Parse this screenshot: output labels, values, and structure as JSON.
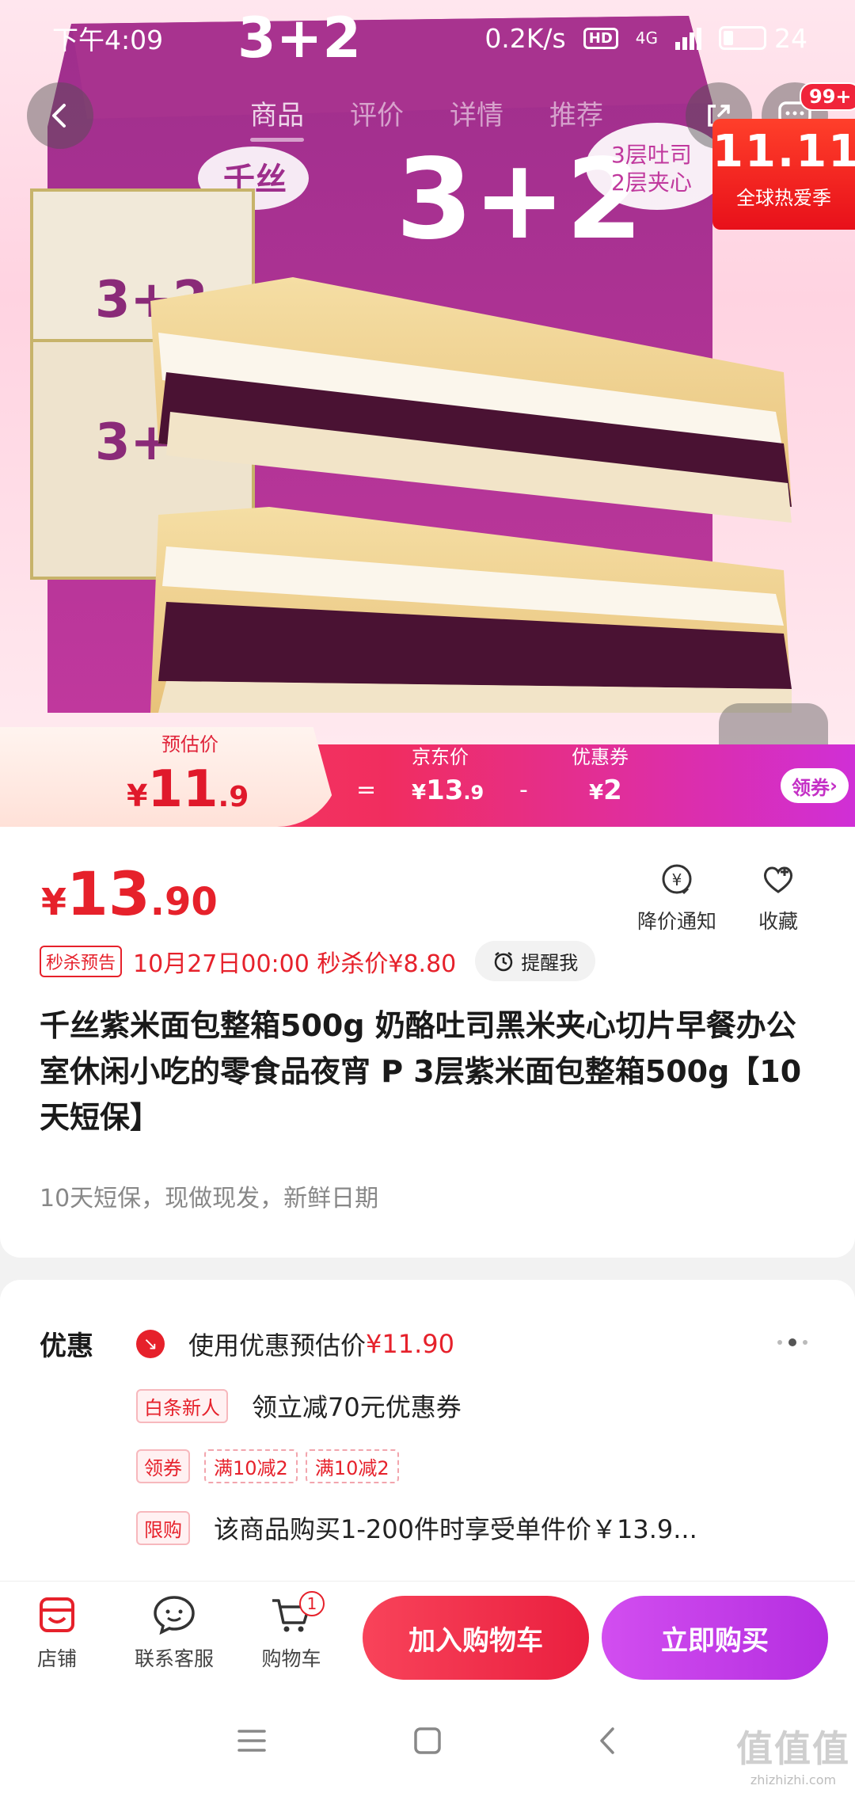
{
  "status_bar": {
    "time": "下午4:09",
    "net_speed": "0.2K/s",
    "hd": "HD",
    "network": "4G",
    "battery": "24"
  },
  "nav": {
    "tabs": [
      "商品",
      "评价",
      "详情",
      "推荐"
    ],
    "active_tab": 0,
    "message_badge": "99+"
  },
  "hero": {
    "product_image": "sandwich-product-photo",
    "brand_logo_text": "千丝",
    "box_text": "3+2",
    "box_side_text": "3层吐司 2层夹心",
    "promo_label_big": "11.11",
    "promo_label_sub": "全球热爱季"
  },
  "price_strip": {
    "est_label": "预估价",
    "est_price": {
      "cur": "¥",
      "int": "11",
      "dec": ".9"
    },
    "eq": "=",
    "jd_label": "京东价",
    "jd_price": {
      "cur": "¥",
      "int": "13",
      "dec": ".9"
    },
    "minus": "-",
    "coupon_label": "优惠券",
    "coupon_price": {
      "cur": "¥",
      "int": "2"
    },
    "claim_label": "领券",
    "claim_arrow": "›"
  },
  "product": {
    "price": {
      "cur": "¥",
      "int": "13",
      "dec": ".90"
    },
    "notify_label": "降价通知",
    "favorite_label": "收藏",
    "flash_tag": "秒杀预告",
    "flash_text": "10月27日00:00 秒杀价¥8.80",
    "remind_label": "提醒我",
    "title": "千丝紫米面包整箱500g 奶酪吐司黑米夹心切片早餐办公室休闲小吃的零食品夜宵 P 3层紫米面包整箱500g【10天短保】",
    "subtitle": "10天短保，现做现发，新鲜日期"
  },
  "promotions": {
    "heading": "优惠",
    "row1": {
      "text": "使用优惠预估价",
      "price": "¥11.90"
    },
    "row2": {
      "tag": "白条新人",
      "text": "领立减70元优惠券"
    },
    "row3": {
      "tag": "领券",
      "coupons": [
        "满10减2",
        "满10减2"
      ]
    },
    "row4": {
      "tag": "限购",
      "text": "该商品购买1-200件时享受单件价￥13.9..."
    }
  },
  "action_bar": {
    "shop_label": "店铺",
    "service_label": "联系客服",
    "cart_label": "购物车",
    "cart_count": "1",
    "add_cart_label": "加入购物车",
    "buy_now_label": "立即购买"
  },
  "watermark": {
    "big": "值值值",
    "small": "zhizhizhi.com"
  },
  "colors": {
    "accent_red": "#e6212b",
    "accent_purple": "#b52ee0"
  }
}
